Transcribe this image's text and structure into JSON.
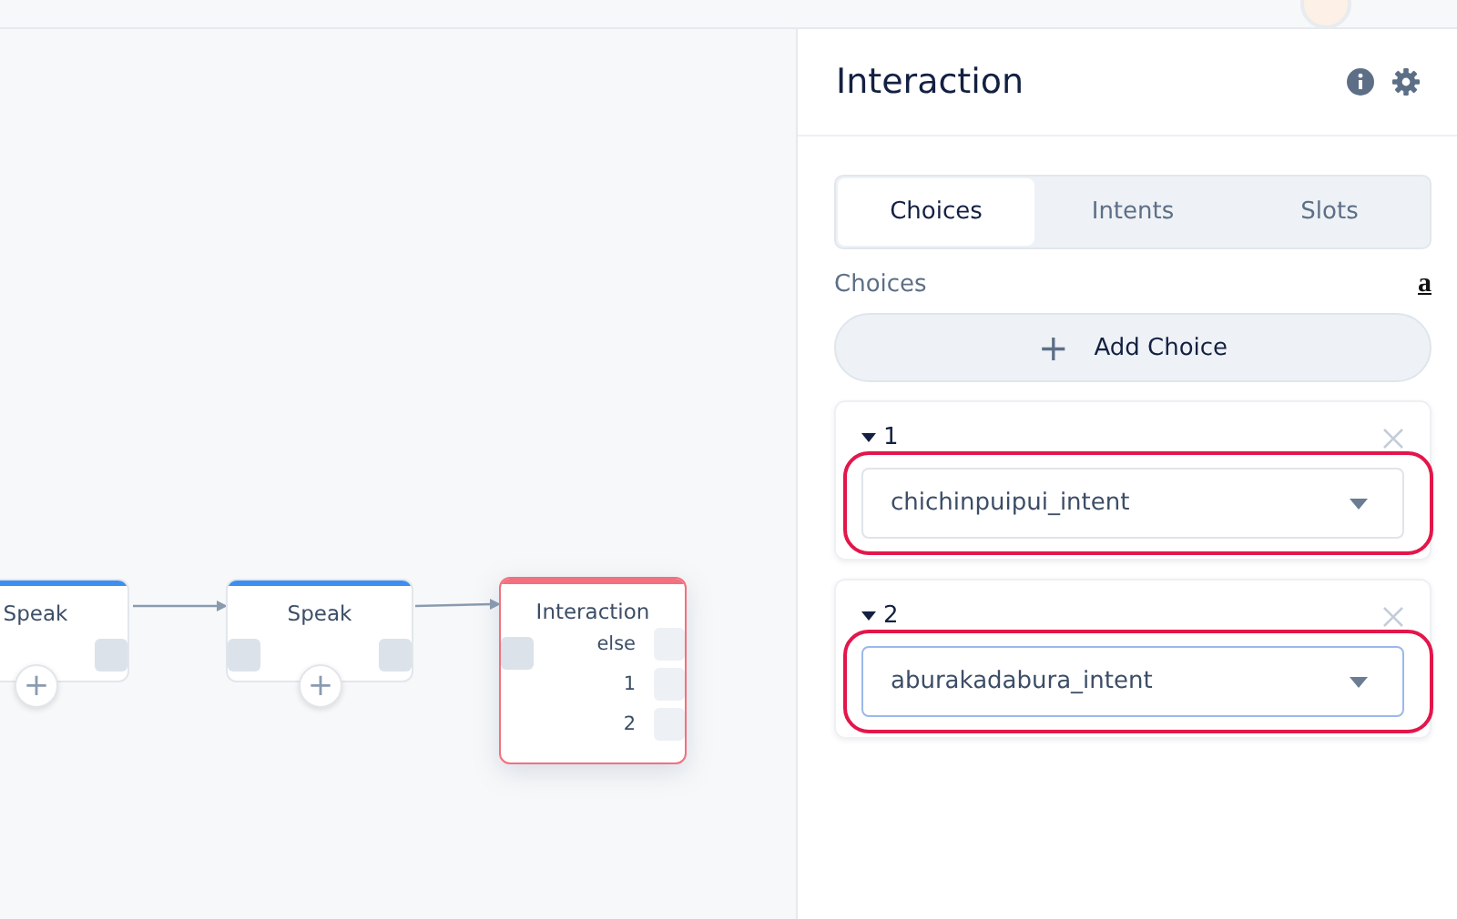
{
  "canvas": {
    "nodes": [
      {
        "title": "Speak",
        "kind": "speak",
        "color": "#3d8ef0",
        "add_button": "+"
      },
      {
        "title": "Speak",
        "kind": "speak",
        "color": "#3d8ef0",
        "add_button": "+"
      },
      {
        "title": "Interaction",
        "kind": "interaction",
        "color": "#f2707f",
        "ports": [
          "else",
          "1",
          "2"
        ]
      }
    ]
  },
  "panel": {
    "title": "Interaction",
    "tabs": [
      {
        "label": "Choices",
        "selected": true
      },
      {
        "label": "Intents",
        "selected": false
      },
      {
        "label": "Slots",
        "selected": false
      }
    ],
    "section_label": "Choices",
    "amazon_mark": "a",
    "add_button": {
      "icon": "+",
      "label": "Add Choice"
    },
    "choices": [
      {
        "number": "1",
        "intent": "chichinpuipui_intent",
        "focused": false,
        "highlighted": true
      },
      {
        "number": "2",
        "intent": "aburakadabura_intent",
        "focused": true,
        "highlighted": true
      }
    ]
  }
}
